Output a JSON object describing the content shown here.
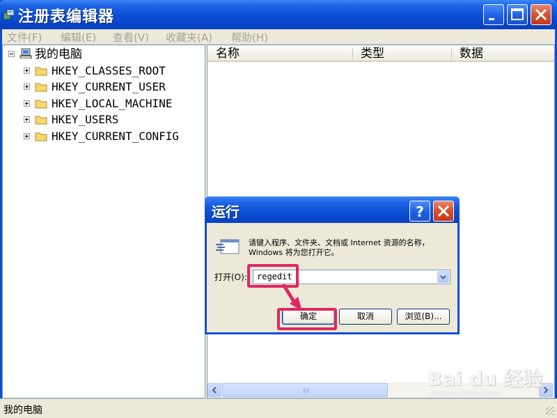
{
  "window": {
    "title": "注册表编辑器",
    "buttons": {
      "minimize": "minimize",
      "maximize": "maximize",
      "close": "close"
    }
  },
  "menu": {
    "items": [
      "文件(F)",
      "编辑(E)",
      "查看(V)",
      "收藏夹(A)",
      "帮助(H)"
    ]
  },
  "tree": {
    "root": "我的电脑",
    "keys": [
      "HKEY_CLASSES_ROOT",
      "HKEY_CURRENT_USER",
      "HKEY_LOCAL_MACHINE",
      "HKEY_USERS",
      "HKEY_CURRENT_CONFIG"
    ]
  },
  "list": {
    "columns": [
      "名称",
      "类型",
      "数据"
    ]
  },
  "status": {
    "text": "我的电脑"
  },
  "run_dialog": {
    "title": "运行",
    "description": "请键入程序、文件夹、文档或 Internet 资源的名称，Windows 将为您打开它。",
    "open_label": "打开(O):",
    "open_value": "regedit",
    "ok_label": "确定",
    "cancel_label": "取消",
    "browse_label": "浏览(B)..."
  },
  "watermark": {
    "logo": "Bai du 经验",
    "site": "jingyan.baidu.com"
  },
  "colors": {
    "titlebar": "#0a4fd6",
    "highlight": "#e0275f",
    "face": "#ece9d8"
  }
}
